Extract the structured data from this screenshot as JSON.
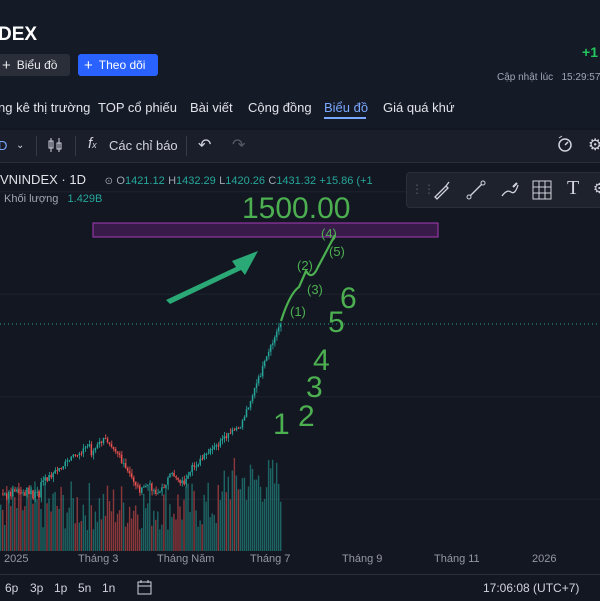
{
  "header": {
    "title": "DEX",
    "change": "+1",
    "updated_label": "Cập nhật lúc",
    "updated_time": "15:29:57",
    "chart_button": "Biểu đồ",
    "follow_button": "Theo dõi"
  },
  "nav": {
    "items": [
      "ng kê thị trường",
      "TOP cổ phiếu",
      "Bài viết",
      "Cộng đồng",
      "Biểu đồ",
      "Giá quá khứ"
    ],
    "active": "Biểu đồ"
  },
  "toolbar": {
    "interval_stub": "D",
    "indicators": "Các chỉ báo"
  },
  "legend": {
    "symbol": "VNINDEX · 1D",
    "open_label": "O",
    "open": "1421.12",
    "high_label": "H",
    "high": "1432.29",
    "low_label": "L",
    "low": "1420.26",
    "close_label": "C",
    "close": "1431.32",
    "change": "+15.86 (+1",
    "volume_label": "Khối lượng",
    "volume": "1.429B"
  },
  "annotations": {
    "target": "1500.00",
    "waves_small": [
      "(1)",
      "(2)",
      "(3)",
      "(4)",
      "(5)"
    ],
    "waves_large": [
      "1",
      "2",
      "3",
      "4",
      "5",
      "6"
    ]
  },
  "x_axis": [
    "2025",
    "Tháng 3",
    "Tháng Năm",
    "Tháng 7",
    "Tháng 9",
    "Tháng 11",
    "2026"
  ],
  "bottom": {
    "timeframes": [
      "6p",
      "3p",
      "1p",
      "5n",
      "1n"
    ],
    "clock": "17:06:08 (UTC+7)"
  },
  "colors": {
    "up": "#26a69a",
    "down": "#ef5350",
    "annotation": "#4caf50",
    "zone": "#9c27b0",
    "accent": "#2962ff"
  },
  "icons": [
    "plus-icon",
    "candles-icon",
    "fx-icon",
    "undo-icon",
    "redo-icon",
    "alert-icon",
    "settings-icon",
    "pen-icon",
    "trendline-icon",
    "brush-icon",
    "grid-icon",
    "text-icon"
  ]
}
